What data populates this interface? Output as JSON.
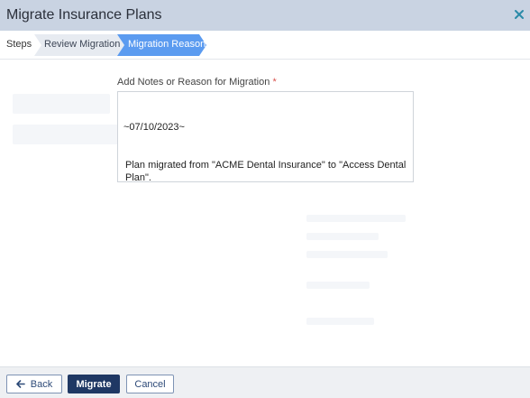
{
  "dialog": {
    "title": "Migrate Insurance Plans"
  },
  "steps": {
    "label": "Steps",
    "items": [
      {
        "label": "Review Migration",
        "state": "complete"
      },
      {
        "label": "Migration Reason",
        "state": "active"
      }
    ]
  },
  "form": {
    "notes_label": "Add Notes or Reason for Migration",
    "required_marker": "*",
    "notes_line1": "~07/10/2023~",
    "notes_line2": "Plan migrated from \"ACME Dental Insurance\" to \"Access Dental Plan\"."
  },
  "footer": {
    "back_label": "Back",
    "migrate_label": "Migrate",
    "cancel_label": "Cancel"
  },
  "colors": {
    "header_bg": "#c9d3e2",
    "active_step": "#5b9bf0",
    "primary_button": "#1f3864",
    "close_icon": "#2a8aa8"
  }
}
